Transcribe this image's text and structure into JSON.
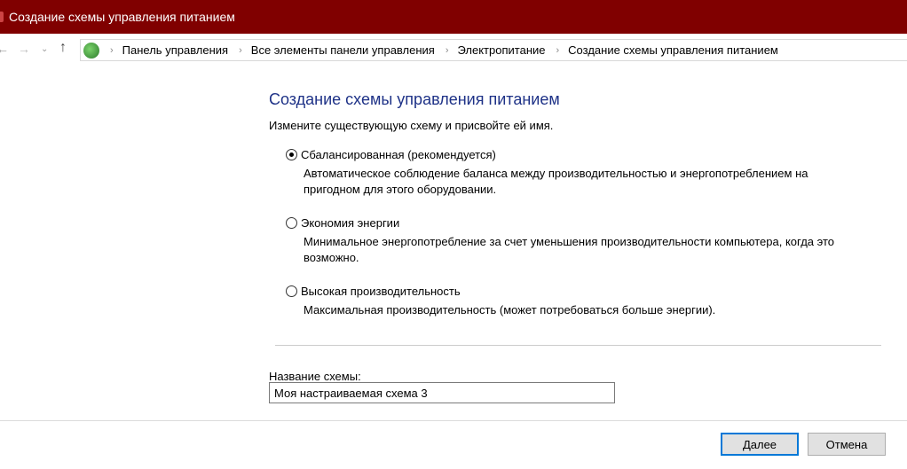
{
  "window": {
    "title": "Создание схемы управления питанием"
  },
  "breadcrumb": [
    "Панель управления",
    "Все элементы панели управления",
    "Электропитание",
    "Создание схемы управления питанием"
  ],
  "main": {
    "heading": "Создание схемы управления питанием",
    "subtitle": "Измените существующую схему и присвойте ей имя.",
    "options": [
      {
        "label": "Сбалансированная (рекомендуется)",
        "desc1": "Автоматическое соблюдение баланса между производительностью и энергопотреблением на",
        "desc2": "пригодном для этого оборудовании.",
        "selected": true
      },
      {
        "label": "Экономия энергии",
        "desc1": "Минимальное энергопотребление за счет уменьшения производительности компьютера, когда это",
        "desc2": "возможно.",
        "selected": false
      },
      {
        "label": "Высокая производительность",
        "desc1": "Максимальная производительность (может потребоваться больше энергии).",
        "desc2": "",
        "selected": false
      }
    ],
    "name_label": "Название схемы:",
    "name_value": "Моя настраиваемая схема 3"
  },
  "buttons": {
    "next": "Далее",
    "cancel": "Отмена"
  }
}
